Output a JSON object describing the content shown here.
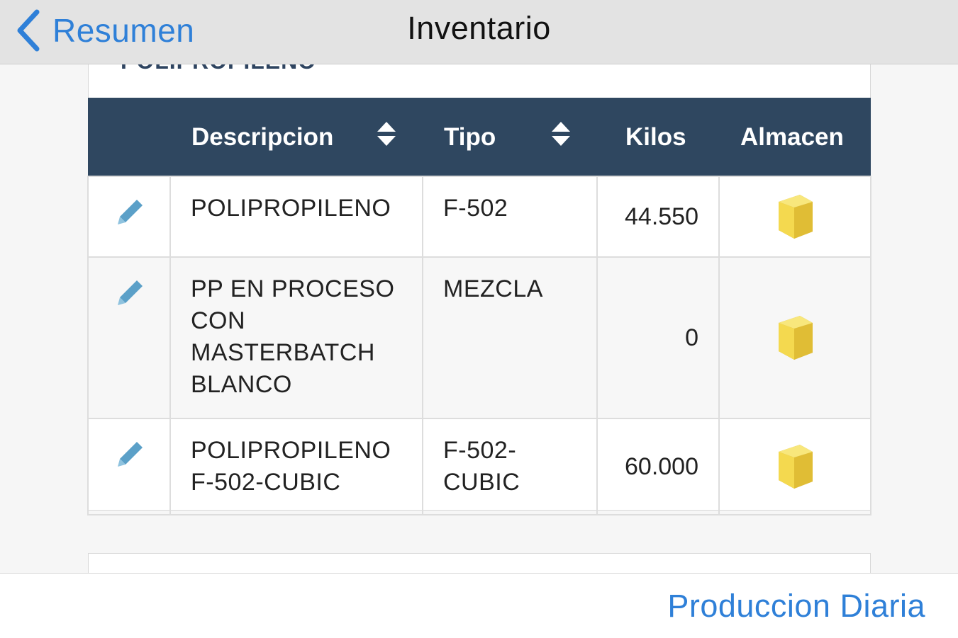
{
  "navbar": {
    "back_label": "Resumen",
    "title": "Inventario"
  },
  "section": {
    "title": "POLIPROPILENO"
  },
  "table": {
    "headers": {
      "edit": "",
      "descripcion": "Descripcion",
      "tipo": "Tipo",
      "kilos": "Kilos",
      "almacen": "Almacen"
    },
    "rows": [
      {
        "descripcion": "POLIPROPILENO",
        "tipo": "F-502",
        "kilos": "44.550",
        "edit_icon": "pencil-icon",
        "almacen_icon": "box-icon"
      },
      {
        "descripcion": "PP EN PROCESO CON MASTERBATCH BLANCO",
        "tipo": "MEZCLA",
        "kilos": "0",
        "edit_icon": "pencil-icon",
        "almacen_icon": "box-icon"
      },
      {
        "descripcion": "POLIPROPILENO F-502-CUBIC",
        "tipo": "F-502-CUBIC",
        "kilos": "60.000",
        "edit_icon": "pencil-icon",
        "almacen_icon": "box-icon"
      }
    ]
  },
  "footer": {
    "link_label": "Produccion Diaria"
  },
  "colors": {
    "accent": "#2f80d8",
    "header_bg": "#2f4760",
    "navbar_bg": "#e3e3e3",
    "box_yellow": "#f2d55a"
  }
}
